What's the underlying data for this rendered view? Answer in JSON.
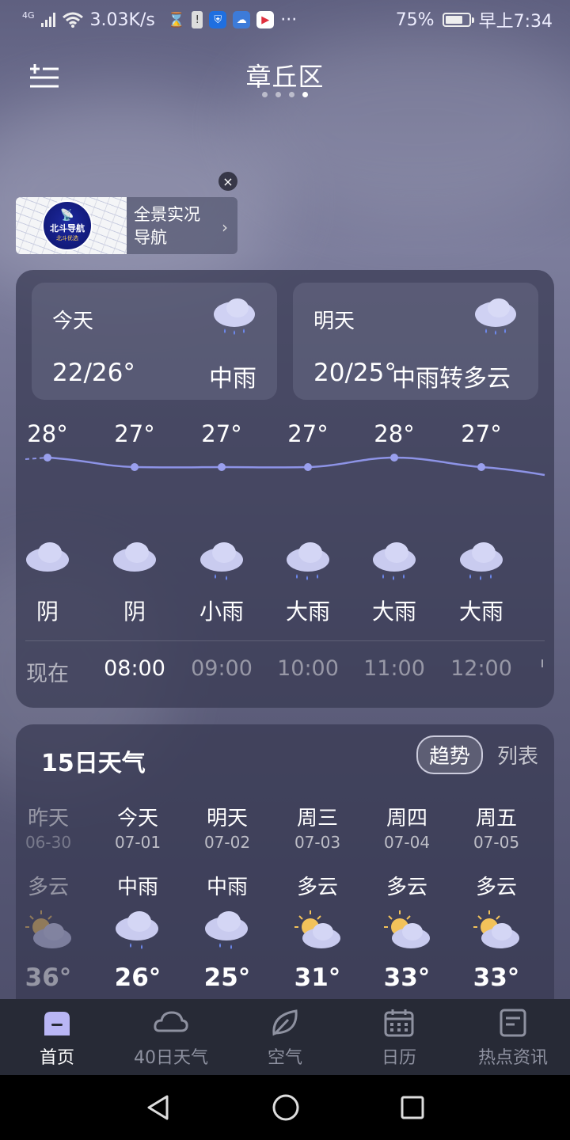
{
  "status": {
    "network": "4G",
    "speed": "3.03K/s",
    "battery": "75%",
    "time": "早上7:34",
    "more": "···"
  },
  "header": {
    "city": "章丘区",
    "page_dots": 4,
    "active_dot": 3
  },
  "ad": {
    "logo_text": "北斗导航",
    "logo_sub": "北斗优选",
    "title_line1": "全景实况",
    "title_line2": "导航",
    "close": "×",
    "arrow": "›"
  },
  "today": {
    "label": "今天",
    "temp": "22/26°",
    "desc": "中雨",
    "icon": "rain-cloud-icon"
  },
  "tomorrow": {
    "label": "明天",
    "temp": "20/25°",
    "desc": "中雨转多云",
    "icon": "rain-cloud-icon"
  },
  "hourly": [
    {
      "temp": "28°",
      "desc": "阴",
      "time": "现在",
      "icon": "cloud"
    },
    {
      "temp": "27°",
      "desc": "阴",
      "time": "08:00",
      "icon": "cloud"
    },
    {
      "temp": "27°",
      "desc": "小雨",
      "time": "09:00",
      "icon": "light-rain"
    },
    {
      "temp": "27°",
      "desc": "大雨",
      "time": "10:00",
      "icon": "heavy-rain"
    },
    {
      "temp": "28°",
      "desc": "大雨",
      "time": "11:00",
      "icon": "heavy-rain"
    },
    {
      "temp": "27°",
      "desc": "大雨",
      "time": "12:00",
      "icon": "heavy-rain"
    }
  ],
  "forecast": {
    "title": "15日天气",
    "toggle_trend": "趋势",
    "toggle_list": "列表",
    "days": [
      {
        "week": "昨天",
        "date": "06-30",
        "weather": "多云",
        "high": "36°",
        "icon": "partly-cloudy"
      },
      {
        "week": "今天",
        "date": "07-01",
        "weather": "中雨",
        "high": "26°",
        "icon": "rain"
      },
      {
        "week": "明天",
        "date": "07-02",
        "weather": "中雨",
        "high": "25°",
        "icon": "rain"
      },
      {
        "week": "周三",
        "date": "07-03",
        "weather": "多云",
        "high": "31°",
        "icon": "partly-cloudy"
      },
      {
        "week": "周四",
        "date": "07-04",
        "weather": "多云",
        "high": "33°",
        "icon": "partly-cloudy"
      },
      {
        "week": "周五",
        "date": "07-05",
        "weather": "多云",
        "high": "33°",
        "icon": "partly-cloudy"
      }
    ]
  },
  "tabs": [
    {
      "label": "首页",
      "icon": "home-icon",
      "active": true
    },
    {
      "label": "40日天气",
      "icon": "cloud-outline-icon",
      "active": false
    },
    {
      "label": "空气",
      "icon": "leaf-icon",
      "active": false
    },
    {
      "label": "日历",
      "icon": "calendar-icon",
      "active": false
    },
    {
      "label": "热点资讯",
      "icon": "news-icon",
      "active": false
    }
  ],
  "colors": {
    "accent": "#b9b6f5",
    "tabbar": "#272a36",
    "cloud": "#c9cbef"
  }
}
